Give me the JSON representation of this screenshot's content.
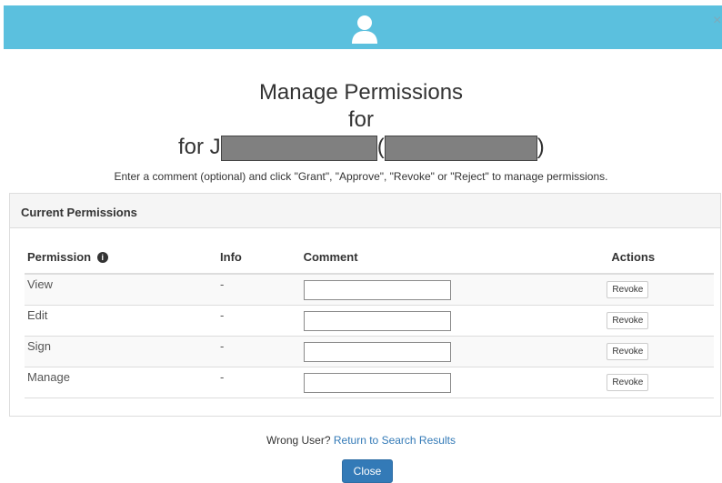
{
  "header": {
    "icon": "user-icon",
    "close_label": "×",
    "color": "#5bc0de"
  },
  "title": {
    "line1": "Manage Permissions",
    "line2": "for",
    "user_prefix": "for J",
    "open_paren": "(",
    "close_paren": ")"
  },
  "instructions": "Enter a comment (optional) and click \"Grant\", \"Approve\", \"Revoke\" or \"Reject\" to manage permissions.",
  "panel": {
    "heading": "Current Permissions",
    "columns": {
      "permission": "Permission",
      "info": "Info",
      "comment": "Comment",
      "actions": "Actions"
    },
    "rows": [
      {
        "permission": "View",
        "info": "-",
        "comment": "",
        "action": "Revoke"
      },
      {
        "permission": "Edit",
        "info": "-",
        "comment": "",
        "action": "Revoke"
      },
      {
        "permission": "Sign",
        "info": "-",
        "comment": "",
        "action": "Revoke"
      },
      {
        "permission": "Manage",
        "info": "-",
        "comment": "",
        "action": "Revoke"
      }
    ]
  },
  "footer": {
    "question": "Wrong User?",
    "link": "Return to Search Results",
    "close_label": "Close"
  },
  "colors": {
    "primary": "#337ab7",
    "header": "#5bc0de"
  }
}
